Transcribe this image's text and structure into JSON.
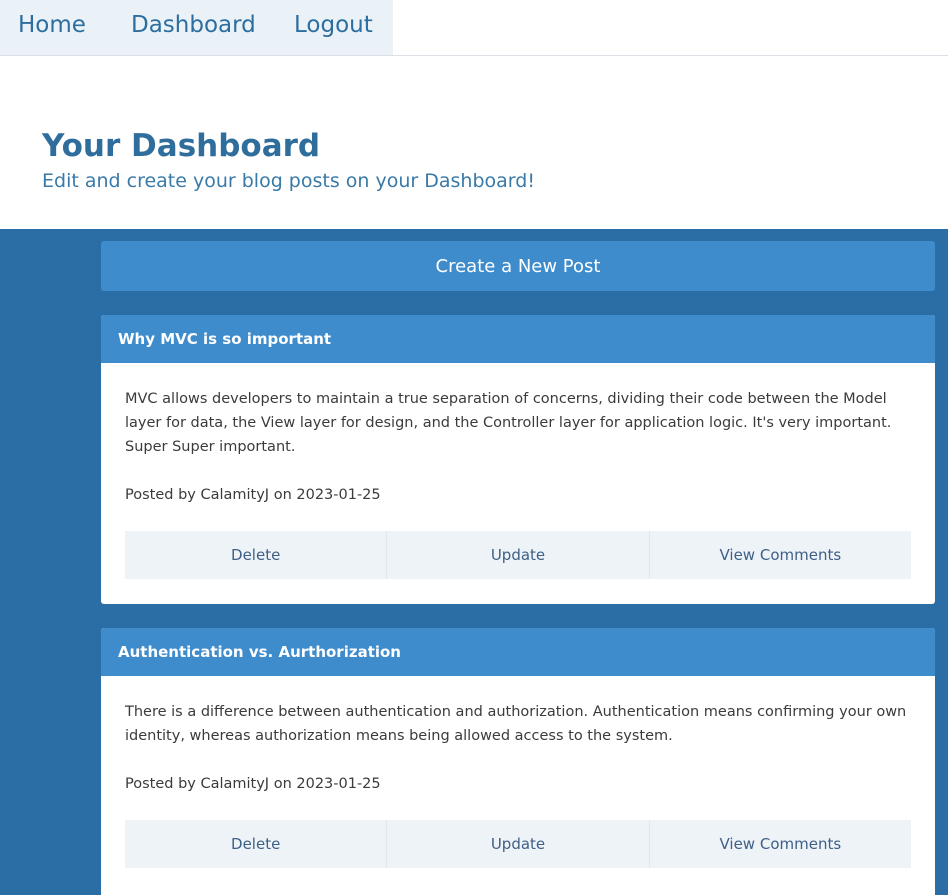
{
  "nav": {
    "home": "Home",
    "dashboard": "Dashboard",
    "logout": "Logout"
  },
  "header": {
    "title": "Your Dashboard",
    "subtitle": "Edit and create your blog posts on your Dashboard!"
  },
  "actions": {
    "create_post": "Create a New Post"
  },
  "posts": [
    {
      "title": "Why MVC is so important",
      "content": "MVC allows developers to maintain a true separation of concerns, dividing their code between the Model layer for data, the View layer for design, and the Controller layer for application logic. It's very important. Super Super important.",
      "meta": "Posted by CalamityJ on 2023-01-25",
      "buttons": {
        "delete": "Delete",
        "update": "Update",
        "comments": "View Comments"
      }
    },
    {
      "title": "Authentication vs. Aurthorization",
      "content": "There is a difference between authentication and authorization. Authentication means confirming your own identity, whereas authorization means being allowed access to the system.",
      "meta": "Posted by CalamityJ on 2023-01-25",
      "buttons": {
        "delete": "Delete",
        "update": "Update",
        "comments": "View Comments"
      }
    }
  ],
  "colors": {
    "primary": "#3f8ccc",
    "band": "#2b6ea6",
    "heading": "#2f6d9c",
    "nav_bg": "#eaf2f8",
    "button_bg": "#eef3f8"
  }
}
